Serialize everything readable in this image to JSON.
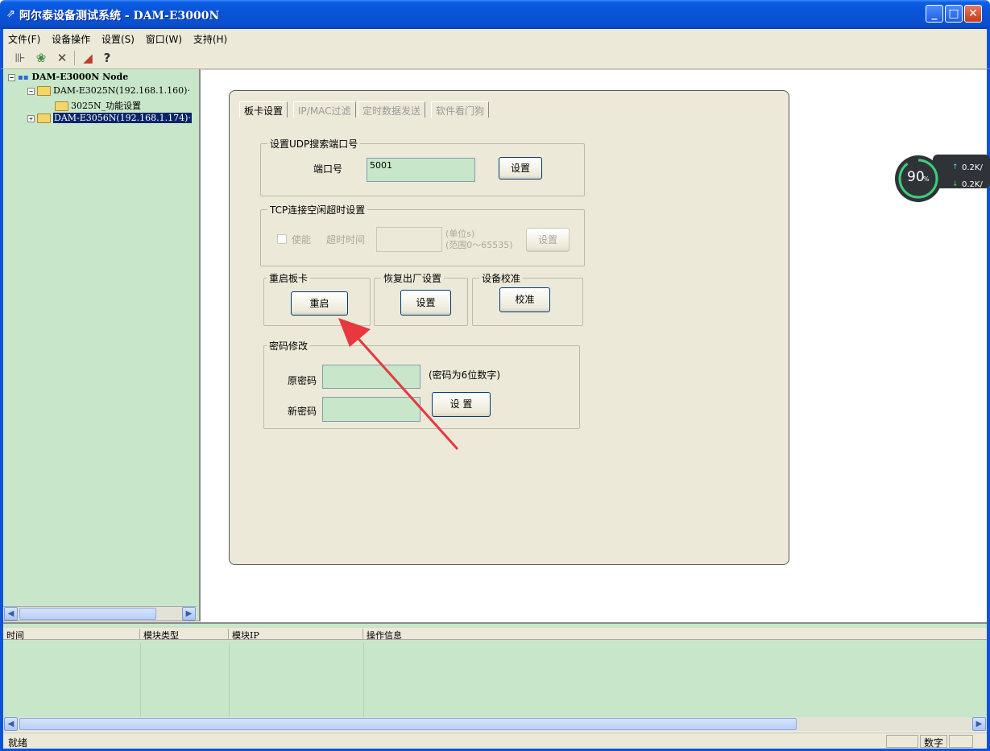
{
  "window": {
    "title": "阿尔泰设备测试系统 - DAM-E3000N"
  },
  "menu": [
    "文件(F)",
    "设备操作",
    "设置(S)",
    "窗口(W)",
    "支持(H)"
  ],
  "toolbar": [
    "connect-icon",
    "paint-icon",
    "delete-icon",
    "chart-icon",
    "help-icon"
  ],
  "tree": {
    "root": "DAM-E3000N Node",
    "device1": "DAM-E3025N(192.168.1.160)·",
    "device1_child": "3025N_功能设置",
    "device2": "DAM-E3056N(192.168.1.174)·"
  },
  "tabs": [
    "板卡设置",
    "IP/MAC过滤",
    "定时数据发送",
    "软件看门狗"
  ],
  "udp": {
    "legend": "设置UDP搜索端口号",
    "port_label": "端口号",
    "port_value": "5001",
    "set_btn": "设置"
  },
  "tcp": {
    "legend": "TCP连接空闲超时设置",
    "enable_label": "使能",
    "timeout_label": "超时时间",
    "unit": "(单位s)",
    "range": "(范围0～65535)",
    "set_btn": "设置"
  },
  "restart": {
    "legend": "重启板卡",
    "btn": "重启"
  },
  "factory": {
    "legend": "恢复出厂设置",
    "btn": "设置"
  },
  "calib": {
    "legend": "设备校准",
    "btn": "校准"
  },
  "password": {
    "legend": "密码修改",
    "old_label": "原密码",
    "new_label": "新密码",
    "hint": "(密码为6位数字)",
    "set_btn": "设 置"
  },
  "gauge": {
    "percent": "90",
    "unit": "%",
    "up": "0.2K/",
    "down": "0.2K/"
  },
  "log": {
    "columns": [
      "时间",
      "模块类型",
      "模块IP",
      "操作信息"
    ]
  },
  "status": {
    "left": "就绪",
    "right": "数字"
  }
}
